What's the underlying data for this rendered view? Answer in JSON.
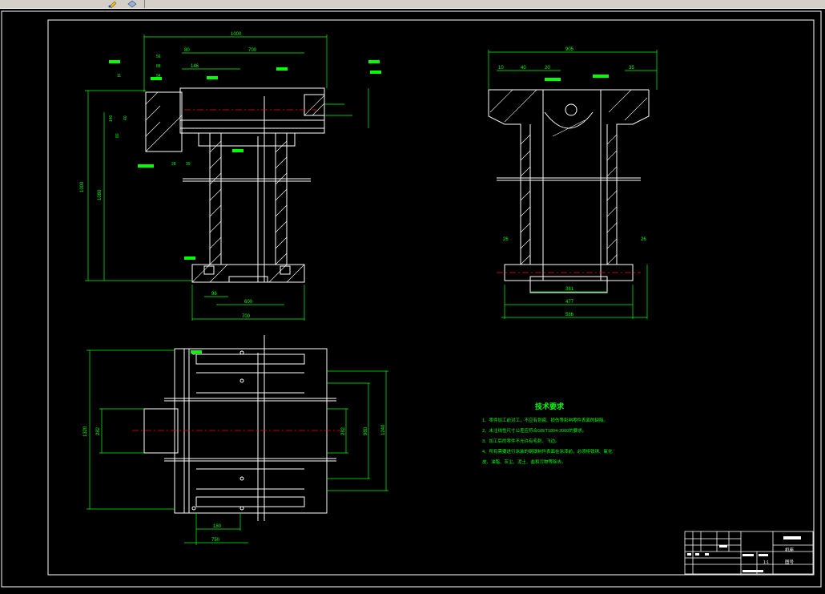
{
  "toolbar": {
    "icons": [
      "pencil-icon",
      "layer-icon"
    ]
  },
  "drawing": {
    "dims": {
      "top_overall": "1000",
      "top_80": "80",
      "top_700": "700",
      "top_146": "146",
      "left_1000": "1000",
      "left_1080": "1080",
      "left_dims": [
        "11",
        "56",
        "88",
        "94",
        "140",
        "80",
        "40",
        "28",
        "39"
      ],
      "front_base_bottom": "700",
      "front_base_600": "600",
      "front_base_96": "96",
      "side_overall": "905",
      "side_10": "10",
      "side_40": "40",
      "side_20": "20",
      "side_35": "35",
      "side_26_left": "26",
      "side_26_right": "26",
      "side_381": "381",
      "side_477": "477",
      "side_586": "586",
      "plan_1320": "1320",
      "plan_282_left": "282",
      "plan_282_right": "282",
      "plan_980": "980",
      "plan_1240": "1240",
      "plan_180": "180",
      "plan_750": "750"
    },
    "notes": {
      "title": "技术要求",
      "lines": [
        "1、零件加工前对工，不应有划痕、损伤等影响零件表面的缺陷。",
        "2、未注线性尺寸公差应符合GB/T1804-2000的要求。",
        "3、加工后的零件不允许有毛刺、飞边。",
        "4、所有需要进行涂装的钢铁制件表面在涂漆前，必须将铁锈、氧化",
        "皮、油脂、灰尘、泥土、盐和污物等除去。"
      ]
    },
    "title_block": {
      "name_cell": "机座",
      "code_cell": "图号",
      "scale_cell": "1:1"
    }
  },
  "colors": {
    "background": "#000000",
    "frame": "#ffffff",
    "dimension": "#00ff00",
    "centerline": "#ff0000",
    "object": "#ffffff"
  }
}
